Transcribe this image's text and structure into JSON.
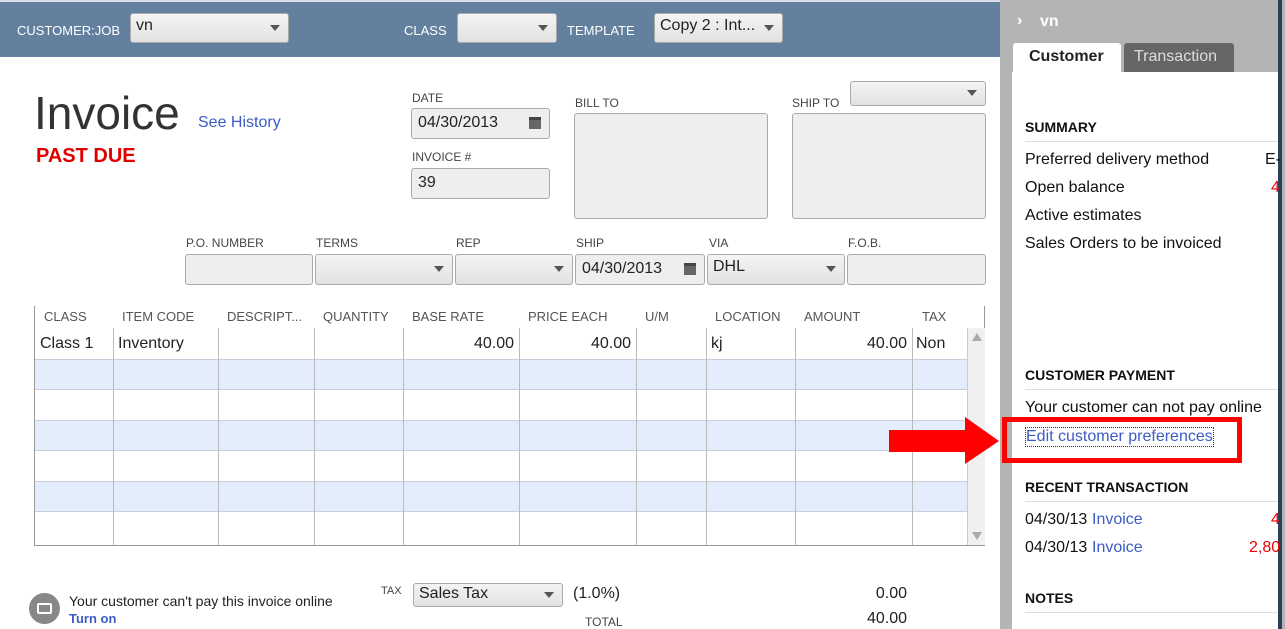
{
  "header": {
    "customer_job_label": "CUSTOMER:JOB",
    "customer_job_value": "vn",
    "class_label": "CLASS",
    "class_value": "",
    "template_label": "TEMPLATE",
    "template_value": "Copy 2 : Int..."
  },
  "invoice": {
    "title": "Invoice",
    "see_history": "See History",
    "status": "PAST DUE",
    "date_label": "DATE",
    "date_value": "04/30/2013",
    "invoice_no_label": "INVOICE #",
    "invoice_no_value": "39",
    "bill_to_label": "BILL TO",
    "ship_to_label": "SHIP TO"
  },
  "fields": {
    "po_label": "P.O. NUMBER",
    "terms_label": "TERMS",
    "rep_label": "REP",
    "ship_label": "SHIP",
    "ship_value": "04/30/2013",
    "via_label": "VIA",
    "via_value": "DHL",
    "fob_label": "F.O.B."
  },
  "table": {
    "columns": [
      "CLASS",
      "ITEM CODE",
      "DESCRIPT...",
      "QUANTITY",
      "BASE RATE",
      "PRICE EACH",
      "U/M",
      "LOCATION",
      "AMOUNT",
      "TAX"
    ],
    "rows": [
      {
        "class": "Class 1",
        "item": "Inventory",
        "base_rate": "40.00",
        "price_each": "40.00",
        "location": "kj",
        "amount": "40.00",
        "tax": "Non"
      }
    ]
  },
  "footer": {
    "online_msg": "Your customer can't pay this invoice online",
    "turn_on": "Turn on",
    "tax_label": "TAX",
    "tax_value": "Sales Tax",
    "tax_rate": "(1.0%)",
    "tax_amount": "0.00",
    "total_label": "TOTAL",
    "total_value": "40.00"
  },
  "sidebar": {
    "name": "vn",
    "tabs": [
      "Customer",
      "Transaction"
    ],
    "summary_title": "SUMMARY",
    "summary": [
      {
        "label": "Preferred delivery method",
        "value": "E-"
      },
      {
        "label": "Open balance",
        "value": "4"
      },
      {
        "label": "Active estimates",
        "value": ""
      },
      {
        "label": "Sales Orders to be invoiced",
        "value": ""
      }
    ],
    "payment_title": "CUSTOMER PAYMENT",
    "payment_msg": "Your customer can not pay online",
    "edit_prefs": "Edit customer preferences",
    "recent_title": "RECENT TRANSACTION",
    "recent": [
      {
        "date": "04/30/13",
        "type": "Invoice",
        "amount": "4"
      },
      {
        "date": "04/30/13",
        "type": "Invoice",
        "amount": "2,80"
      }
    ],
    "notes_title": "NOTES"
  },
  "colors": {
    "header": "#64809f",
    "past_due": "#e00000",
    "link": "#3b5cc4",
    "highlight": "#ff0000"
  }
}
